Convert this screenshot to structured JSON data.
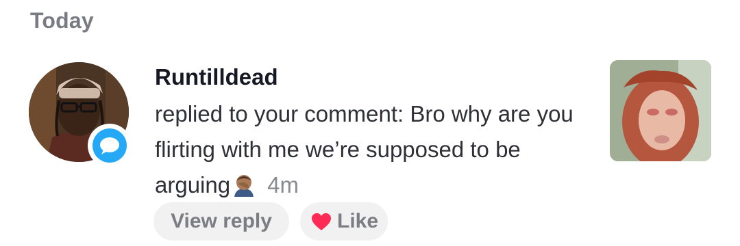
{
  "section": {
    "title": "Today"
  },
  "notification": {
    "username": "Runtilldead",
    "message": "replied to your comment: Bro why are you flirting with me we’re supposed to be arguing",
    "emoji": "man-facepalming-emoji",
    "time": "4m",
    "badge_icon": "comment-bubble-icon",
    "badge_color": "#25a8f5"
  },
  "actions": {
    "view_reply": "View reply",
    "like": "Like",
    "like_icon": "heart-icon",
    "heart_color": "#fe2c55"
  }
}
